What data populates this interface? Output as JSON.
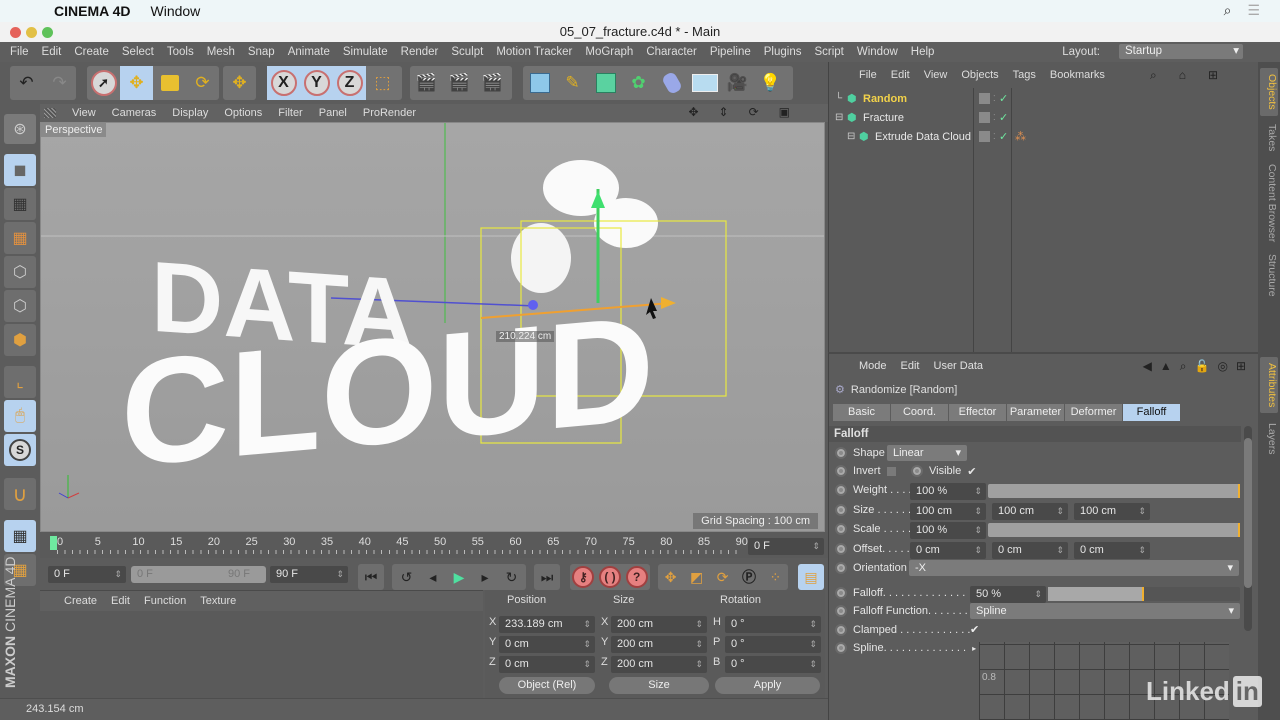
{
  "mac_menubar": {
    "app_name": "CINEMA 4D",
    "menus": [
      "Window"
    ],
    "apple_icon": "",
    "search_icon": "⌕",
    "list_icon": "☰"
  },
  "window": {
    "title": "05_07_fracture.c4d * - Main"
  },
  "app_menu": {
    "items": [
      "File",
      "Edit",
      "Create",
      "Select",
      "Tools",
      "Mesh",
      "Snap",
      "Animate",
      "Simulate",
      "Render",
      "Sculpt",
      "Motion Tracker",
      "MoGraph",
      "Character",
      "Pipeline",
      "Plugins",
      "Script",
      "Window",
      "Help"
    ],
    "layout_label": "Layout:",
    "layout_value": "Startup"
  },
  "toolbar": {
    "axis_buttons": [
      "X",
      "Y",
      "Z"
    ]
  },
  "viewport": {
    "menu": [
      "View",
      "Cameras",
      "Display",
      "Options",
      "Filter",
      "Panel",
      "ProRender"
    ],
    "camera_label": "Perspective",
    "grid_spacing": "Grid Spacing : 100 cm",
    "measure_label": "210.224 cm",
    "scene_text_line1": "DATA",
    "scene_text_line2": "CLOUD"
  },
  "timeline": {
    "ticks": [
      "0",
      "5",
      "10",
      "15",
      "20",
      "25",
      "30",
      "35",
      "40",
      "45",
      "50",
      "55",
      "60",
      "65",
      "70",
      "75",
      "80",
      "85",
      "90"
    ],
    "current_frame": "0 F",
    "start_frame": "0 F",
    "range_start": "0 F",
    "range_end": "90 F",
    "end_frame": "90 F"
  },
  "material_panel": {
    "menu": [
      "Create",
      "Edit",
      "Function",
      "Texture"
    ]
  },
  "coordinates": {
    "headers": {
      "position": "Position",
      "size": "Size",
      "rotation": "Rotation"
    },
    "rows": [
      {
        "pos_axis": "X",
        "pos": "233.189 cm",
        "size_axis": "X",
        "size": "200 cm",
        "rot_axis": "H",
        "rot": "0 °"
      },
      {
        "pos_axis": "Y",
        "pos": "0 cm",
        "size_axis": "Y",
        "size": "200 cm",
        "rot_axis": "P",
        "rot": "0 °"
      },
      {
        "pos_axis": "Z",
        "pos": "0 cm",
        "size_axis": "Z",
        "size": "200 cm",
        "rot_axis": "B",
        "rot": "0 °"
      }
    ],
    "mode_dropdown": "Object (Rel)",
    "size_dropdown": "Size",
    "apply_label": "Apply"
  },
  "status_bar": {
    "text": "243.154 cm"
  },
  "branding": {
    "maxon": "MAXON",
    "c4d": "CINEMA 4D",
    "linkedin": "Linked",
    "linkedin_in": "in"
  },
  "object_manager": {
    "menu": [
      "File",
      "Edit",
      "View",
      "Objects",
      "Tags",
      "Bookmarks"
    ],
    "objects": [
      {
        "name": "Random",
        "selected": true,
        "color": "#f2d24a"
      },
      {
        "name": "Fracture",
        "selected": false,
        "color": "#e8e8e8"
      },
      {
        "name": "Extrude Data Cloud",
        "selected": false,
        "color": "#e8e8e8"
      }
    ]
  },
  "side_tabs": {
    "top": [
      "Objects",
      "Takes",
      "Content Browser",
      "Structure"
    ],
    "bottom": [
      "Attributes",
      "Layers"
    ]
  },
  "attributes": {
    "menu": [
      "Mode",
      "Edit",
      "User Data"
    ],
    "object_title": "Randomize [Random]",
    "tabs": [
      "Basic",
      "Coord.",
      "Effector",
      "Parameter",
      "Deformer",
      "Falloff"
    ],
    "active_tab": "Falloff",
    "section": "Falloff",
    "shape_label": "Shape",
    "shape_value": "Linear",
    "invert_label": "Invert",
    "invert_checked": false,
    "visible_label": "Visible",
    "visible_checked": true,
    "weight_label": "Weight . . . .",
    "weight_value": "100 %",
    "weight_fraction": 1.0,
    "size_label": "Size . . . . . .",
    "size_values": [
      "100 cm",
      "100 cm",
      "100 cm"
    ],
    "scale_label": "Scale . . . . .",
    "scale_value": "100 %",
    "scale_fraction": 1.0,
    "offset_label": "Offset. . . . .",
    "offset_values": [
      "0 cm",
      "0 cm",
      "0 cm"
    ],
    "orientation_label": "Orientation",
    "orientation_value": "-X",
    "falloff_label": "Falloff. . . . . . . . . . . . . .",
    "falloff_value": "50 %",
    "falloff_fraction": 0.5,
    "falloff_function_label": "Falloff Function. . . . . . . .",
    "falloff_function_value": "Spline",
    "clamped_label": "Clamped . . . . . . . . . . . .",
    "clamped_checked": true,
    "spline_label": "Spline. . . . . . . . . . . . . .",
    "spline_axis_label": "0.8"
  }
}
